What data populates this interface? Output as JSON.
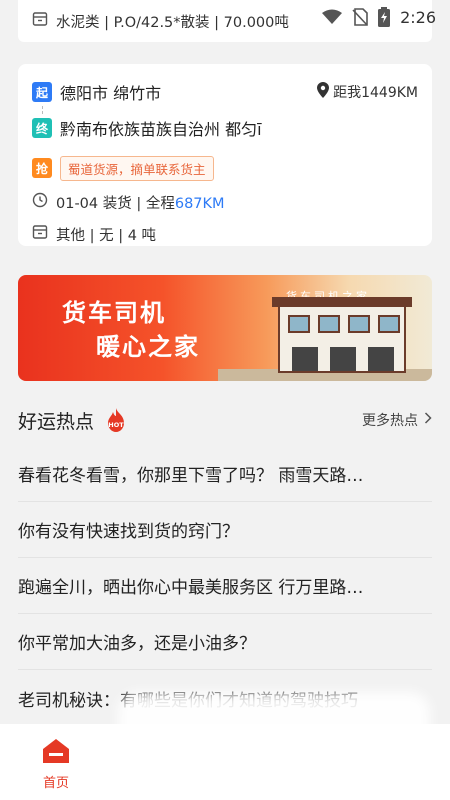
{
  "status_bar": {
    "time": "2:26"
  },
  "prev_card": {
    "cargo": "水泥类 | P.O/42.5*散装 | 70.000吨"
  },
  "order": {
    "start_tag": "起",
    "start_city": "德阳市 绵竹市",
    "distance": "距我1449KM",
    "end_tag": "终",
    "end_city": "黔南布依族苗族自治州 都匀ī",
    "grab_tag": "抢",
    "grab_note": "蜀道货源，摘单联系货主",
    "load_date": "01-04 装货 | 全程",
    "total_distance": "687KM",
    "cargo": "其他 | 无 | 4 吨"
  },
  "banner": {
    "line1": "货车司机",
    "line2": "暖心之家",
    "sign": "货车司机之家"
  },
  "hot": {
    "title": "好运热点",
    "badge": "HOT",
    "more": "更多热点",
    "topics": [
      "春看花冬看雪，你那里下雪了吗？ 雨雪天路…",
      "你有没有快速找到货的窍门？",
      "跑遍全川，晒出你心中最美服务区 行万里路…",
      "你平常加大油多，还是小油多？",
      "老司机秘诀：有哪些是你们才知道的驾驶技巧"
    ]
  },
  "nav": {
    "home": "首页"
  },
  "colors": {
    "accent": "#e53925",
    "blue": "#2e7bf6",
    "teal": "#1fc0b5",
    "orange": "#ff8a1f"
  }
}
